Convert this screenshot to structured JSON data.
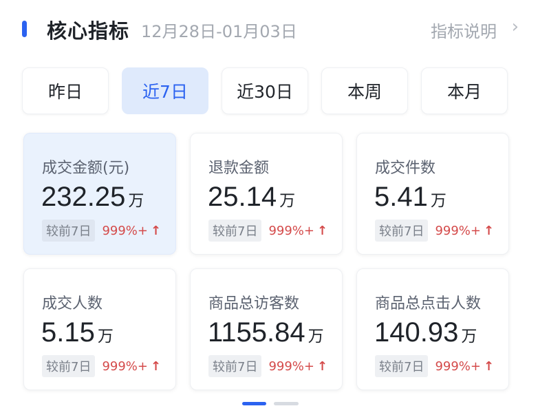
{
  "header": {
    "title": "核心指标",
    "date_range": "12月28日-01月03日",
    "help_link": "指标说明",
    "chevron_icon": "chevron-right-icon"
  },
  "tabs": [
    {
      "label": "昨日",
      "active": false
    },
    {
      "label": "近7日",
      "active": true
    },
    {
      "label": "近30日",
      "active": false
    },
    {
      "label": "本周",
      "active": false
    },
    {
      "label": "本月",
      "active": false
    }
  ],
  "metrics": [
    {
      "label": "成交金额(元)",
      "value": "232.25",
      "unit": "万",
      "compare_label": "较前7日",
      "change": "999%+",
      "trend_icon": "arrow-up-icon",
      "active": true
    },
    {
      "label": "退款金额",
      "value": "25.14",
      "unit": "万",
      "compare_label": "较前7日",
      "change": "999%+",
      "trend_icon": "arrow-up-icon",
      "active": false
    },
    {
      "label": "成交件数",
      "value": "5.41",
      "unit": "万",
      "compare_label": "较前7日",
      "change": "999%+",
      "trend_icon": "arrow-up-icon",
      "active": false
    },
    {
      "label": "成交人数",
      "value": "5.15",
      "unit": "万",
      "compare_label": "较前7日",
      "change": "999%+",
      "trend_icon": "arrow-up-icon",
      "active": false
    },
    {
      "label": "商品总访客数",
      "value": "1155.84",
      "unit": "万",
      "compare_label": "较前7日",
      "change": "999%+",
      "trend_icon": "arrow-up-icon",
      "active": false
    },
    {
      "label": "商品总点击人数",
      "value": "140.93",
      "unit": "万",
      "compare_label": "较前7日",
      "change": "999%+",
      "trend_icon": "arrow-up-icon",
      "active": false
    }
  ],
  "pager": {
    "pages": 2,
    "current": 1
  },
  "colors": {
    "accent": "#2b62f0",
    "up": "#d44a4a",
    "active_bg": "#dfeafc"
  }
}
